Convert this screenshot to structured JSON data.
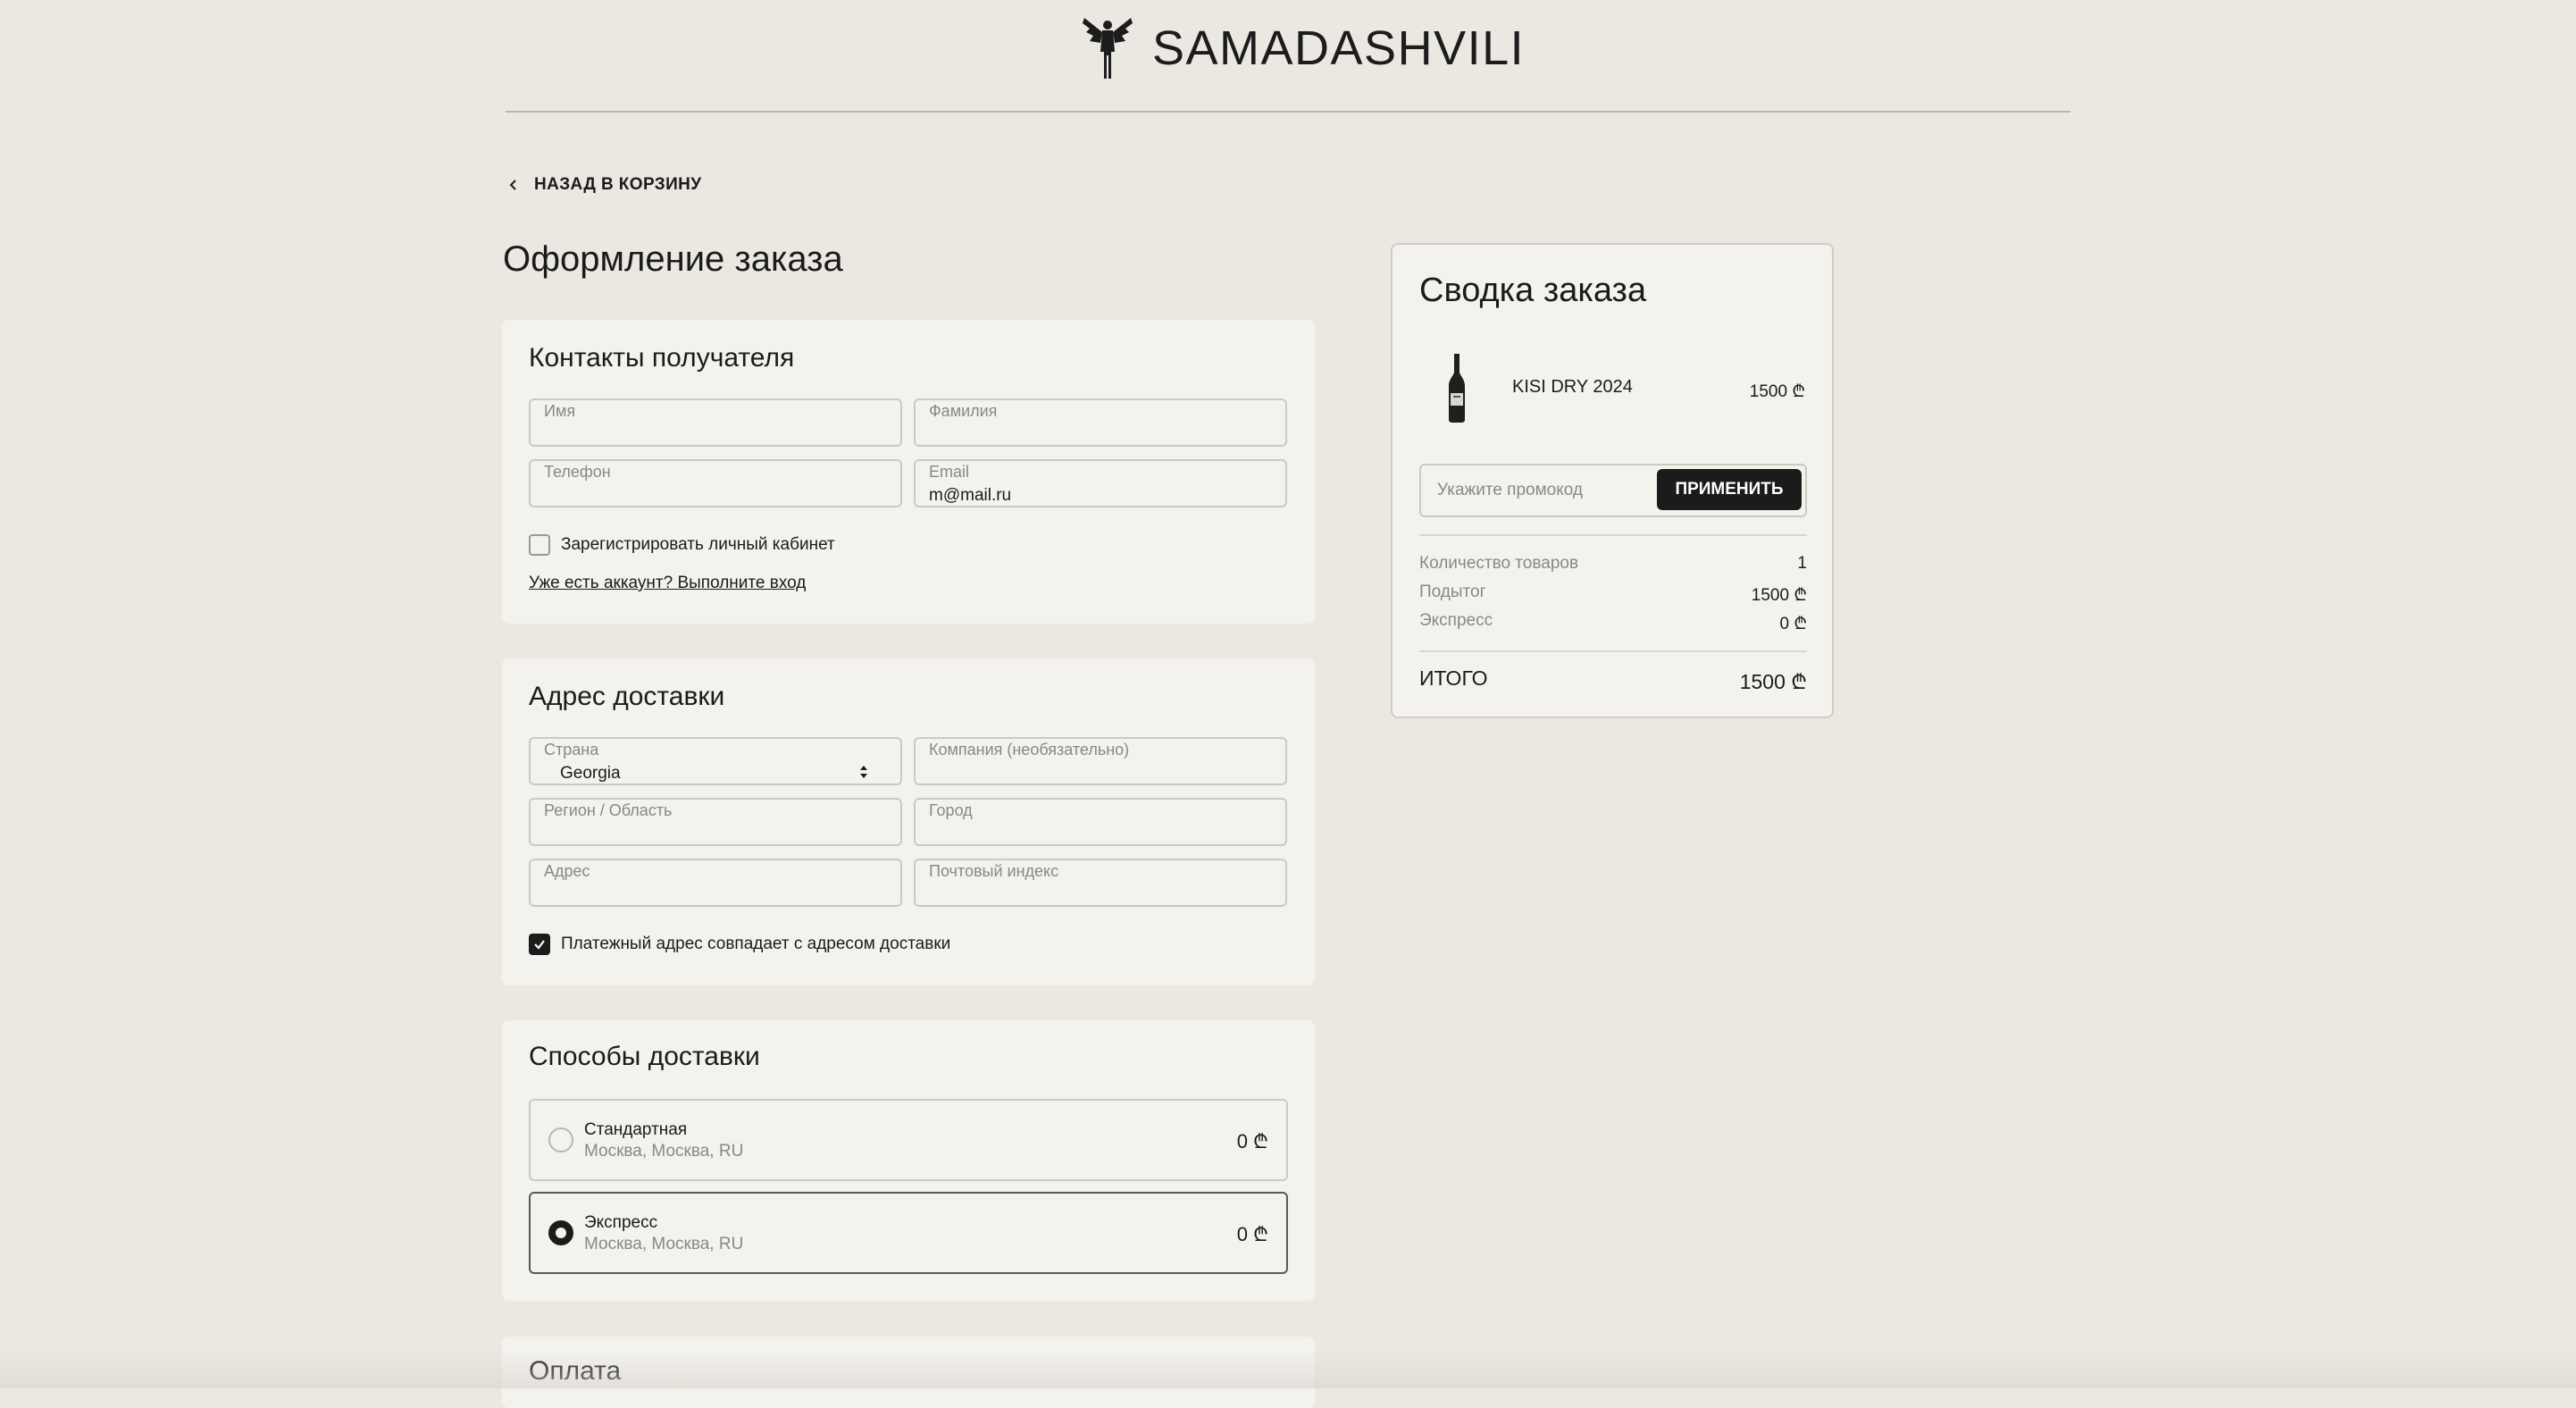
{
  "brand": {
    "name": "SAMADASHVILI"
  },
  "nav": {
    "back_label": "НАЗАД В КОРЗИНУ"
  },
  "page_title": "Оформление заказа",
  "contacts": {
    "title": "Контакты получателя",
    "first_name_label": "Имя",
    "last_name_label": "Фамилия",
    "phone_label": "Телефон",
    "email_label": "Email",
    "email_value": "m@mail.ru",
    "register_label": "Зарегистрировать личный кабинет",
    "register_checked": false,
    "login_link": "Уже есть аккаунт? Выполните вход"
  },
  "address": {
    "title": "Адрес доставки",
    "country_label": "Страна",
    "country_value": "Georgia",
    "company_label": "Компания (необязательно)",
    "region_label": "Регион / Область",
    "city_label": "Город",
    "address_label": "Адрес",
    "zip_label": "Почтовый индекс",
    "billing_same_label": "Платежный адрес совпадает с адресом доставки",
    "billing_same_checked": true
  },
  "shipping": {
    "title": "Способы доставки",
    "options": [
      {
        "name": "Стандартная",
        "location": "Москва, Москва, RU",
        "price": "0 ₾",
        "selected": false
      },
      {
        "name": "Экспресс",
        "location": "Москва, Москва, RU",
        "price": "0 ₾",
        "selected": true
      }
    ]
  },
  "payment": {
    "title": "Оплата"
  },
  "summary": {
    "title": "Сводка заказа",
    "item": {
      "name": "KISI DRY 2024",
      "price": "1500 ₾",
      "image": "wine-bottle-icon"
    },
    "promo_placeholder": "Укажите промокод",
    "promo_button": "ПРИМЕНИТЬ",
    "rows": [
      {
        "label": "Количество товаров",
        "value": "1"
      },
      {
        "label": "Подытог",
        "value": "1500 ₾"
      },
      {
        "label": "Экспресс",
        "value": "0 ₾"
      }
    ],
    "total_label": "ИТОГО",
    "total_value": "1500 ₾"
  },
  "colors": {
    "background": "#ebe8e1",
    "card": "#f4f2ed",
    "accent": "#1b1b1b",
    "muted_text": "#8a8884"
  }
}
